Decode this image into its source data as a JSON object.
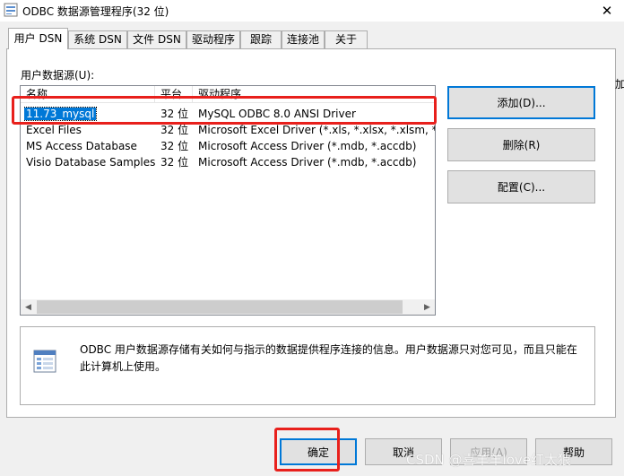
{
  "window": {
    "title": "ODBC 数据源管理程序(32 位)",
    "close_glyph": "✕"
  },
  "tabs": [
    {
      "label": "用户 DSN",
      "active": true
    },
    {
      "label": "系统 DSN",
      "active": false
    },
    {
      "label": "文件 DSN",
      "active": false
    },
    {
      "label": "驱动程序",
      "active": false
    },
    {
      "label": "跟踪",
      "active": false
    },
    {
      "label": "连接池",
      "active": false
    },
    {
      "label": "关于",
      "active": false
    }
  ],
  "user_dsn": {
    "list_label": "用户数据源(U):",
    "columns": [
      "名称",
      "平台",
      "驱动程序"
    ],
    "rows": [
      {
        "name": "11.73_mysql",
        "platform": "32 位",
        "driver": "MySQL ODBC 8.0 ANSI Driver",
        "selected": true
      },
      {
        "name": "Excel Files",
        "platform": "32 位",
        "driver": "Microsoft Excel Driver (*.xls, *.xlsx, *.xlsm, *.xlsb)",
        "selected": false
      },
      {
        "name": "MS Access Database",
        "platform": "32 位",
        "driver": "Microsoft Access Driver (*.mdb, *.accdb)",
        "selected": false
      },
      {
        "name": "Visio Database Samples",
        "platform": "32 位",
        "driver": "Microsoft Access Driver (*.mdb, *.accdb)",
        "selected": false
      }
    ],
    "side_buttons": {
      "add": "添加(D)...",
      "remove": "删除(R)",
      "configure": "配置(C)..."
    },
    "info_text": "ODBC 用户数据源存储有关如何与指示的数据提供程序连接的信息。用户数据源只对您可见，而且只能在此计算机上使用。"
  },
  "footer_buttons": {
    "ok": "确定",
    "cancel": "取消",
    "apply": "应用(A)",
    "help": "帮助"
  },
  "edge_fragment": "加",
  "watermark": "CSDN @喜羊羊love红太狼",
  "colors": {
    "selection": "#0078d7",
    "highlight_box": "#e8201c",
    "panel_bg": "#ffffff",
    "window_bg": "#f0f0f0"
  }
}
